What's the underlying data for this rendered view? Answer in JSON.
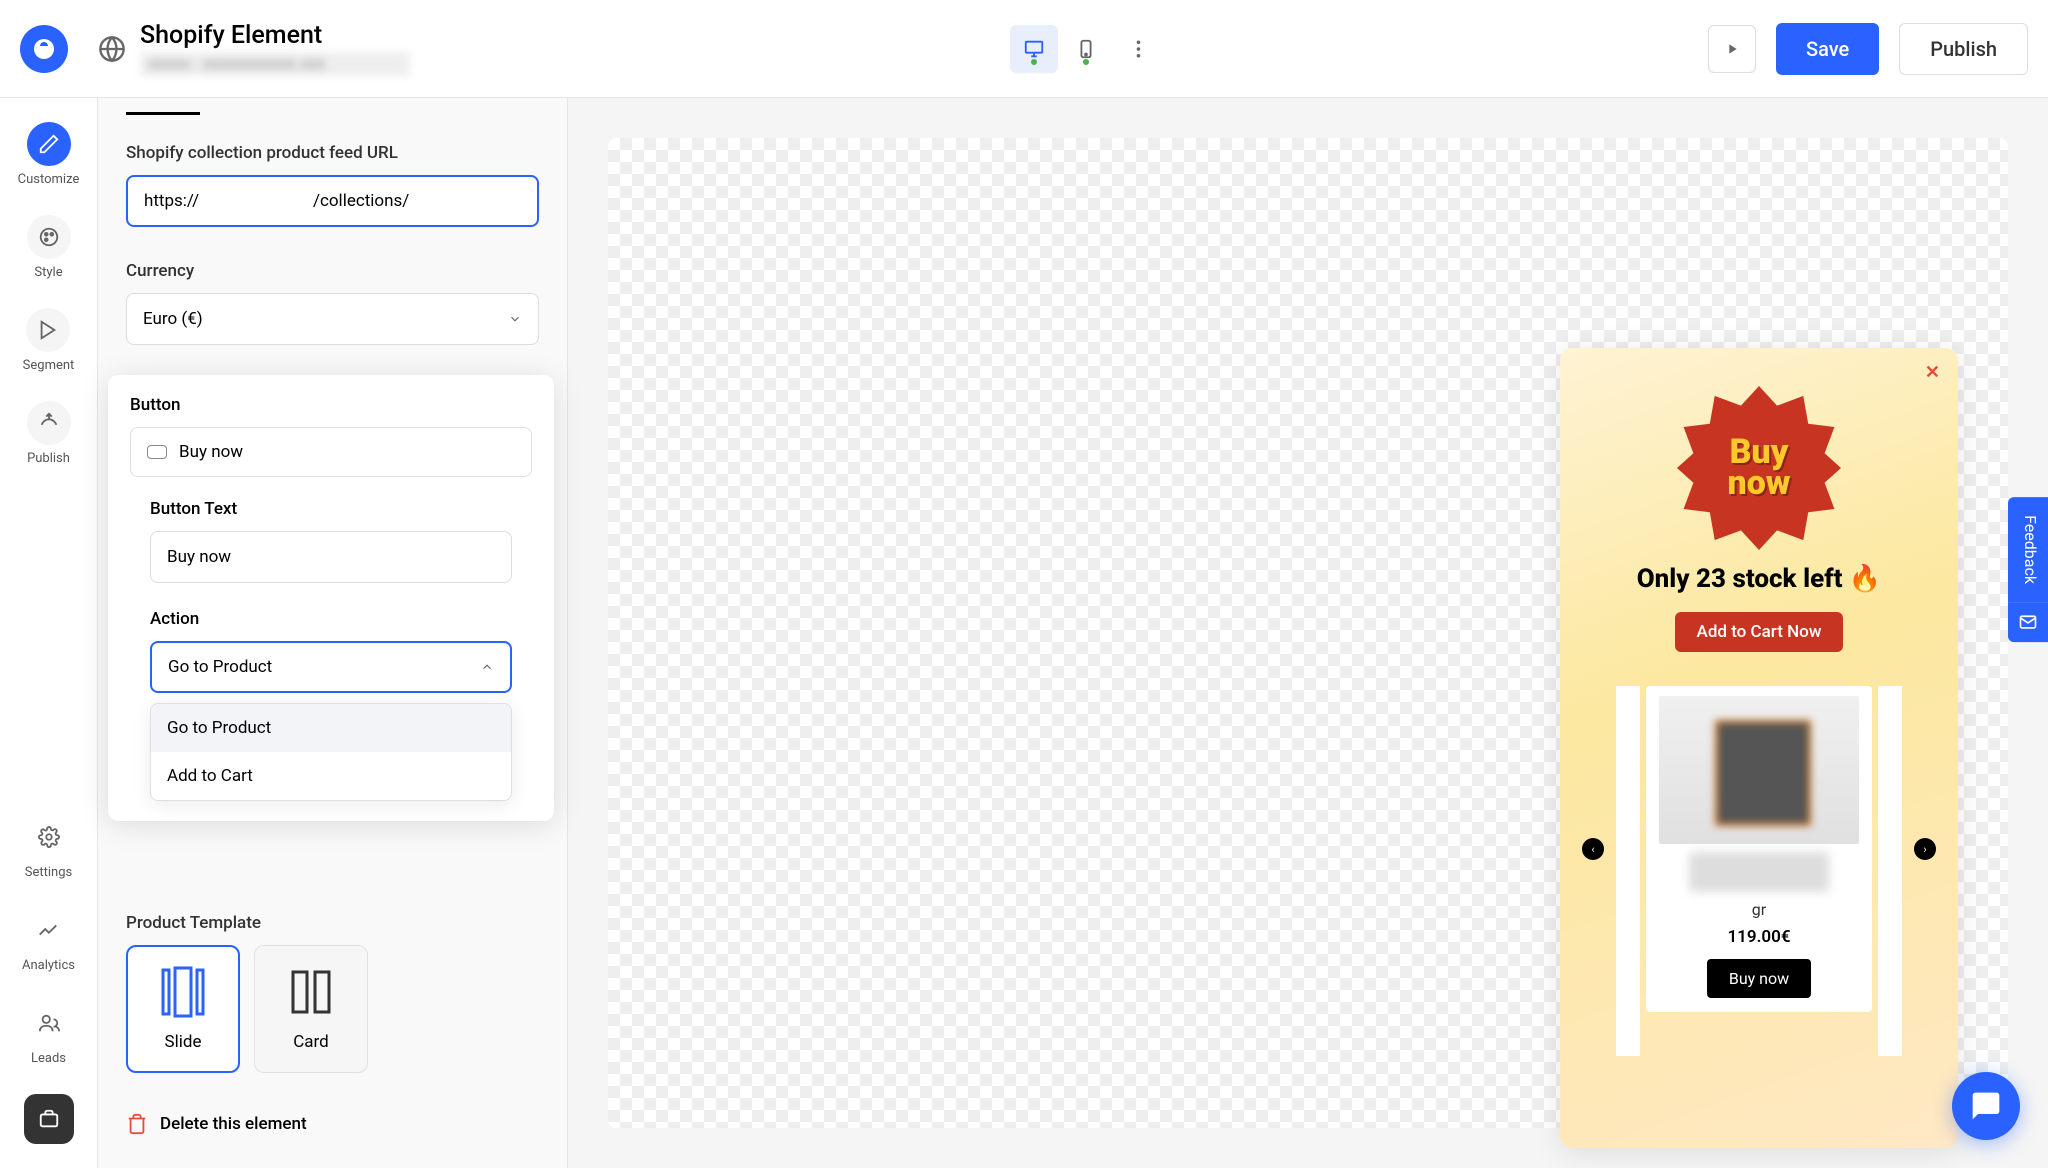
{
  "header": {
    "title": "Shopify Element",
    "subtitle": "xxxxx : xxxxxxxxxxx.xxx",
    "save_label": "Save",
    "publish_label": "Publish"
  },
  "nav": {
    "customize": "Customize",
    "style": "Style",
    "segment": "Segment",
    "publish": "Publish",
    "settings": "Settings",
    "analytics": "Analytics",
    "leads": "Leads"
  },
  "panel": {
    "feed_url_label": "Shopify collection product feed URL",
    "feed_url_value": "https://                           /collections/",
    "currency_label": "Currency",
    "currency_value": "Euro (€)",
    "product_template_label": "Product Template",
    "template_slide": "Slide",
    "template_card": "Card",
    "delete_label": "Delete this element"
  },
  "dropdown": {
    "title": "Button",
    "row_label": "Buy now",
    "button_text_label": "Button Text",
    "button_text_value": "Buy now",
    "action_label": "Action",
    "action_value": "Go to Product",
    "options": [
      "Go to Product",
      "Add to Cart"
    ]
  },
  "popup": {
    "badge_line1": "Buy",
    "badge_line2": "now",
    "headline": "Only 23 stock left 🔥",
    "cta": "Add to Cart Now",
    "product_sub": "gr",
    "product_price": "119.00€",
    "product_btn": "Buy now"
  },
  "feedback": {
    "label": "Feedback"
  }
}
